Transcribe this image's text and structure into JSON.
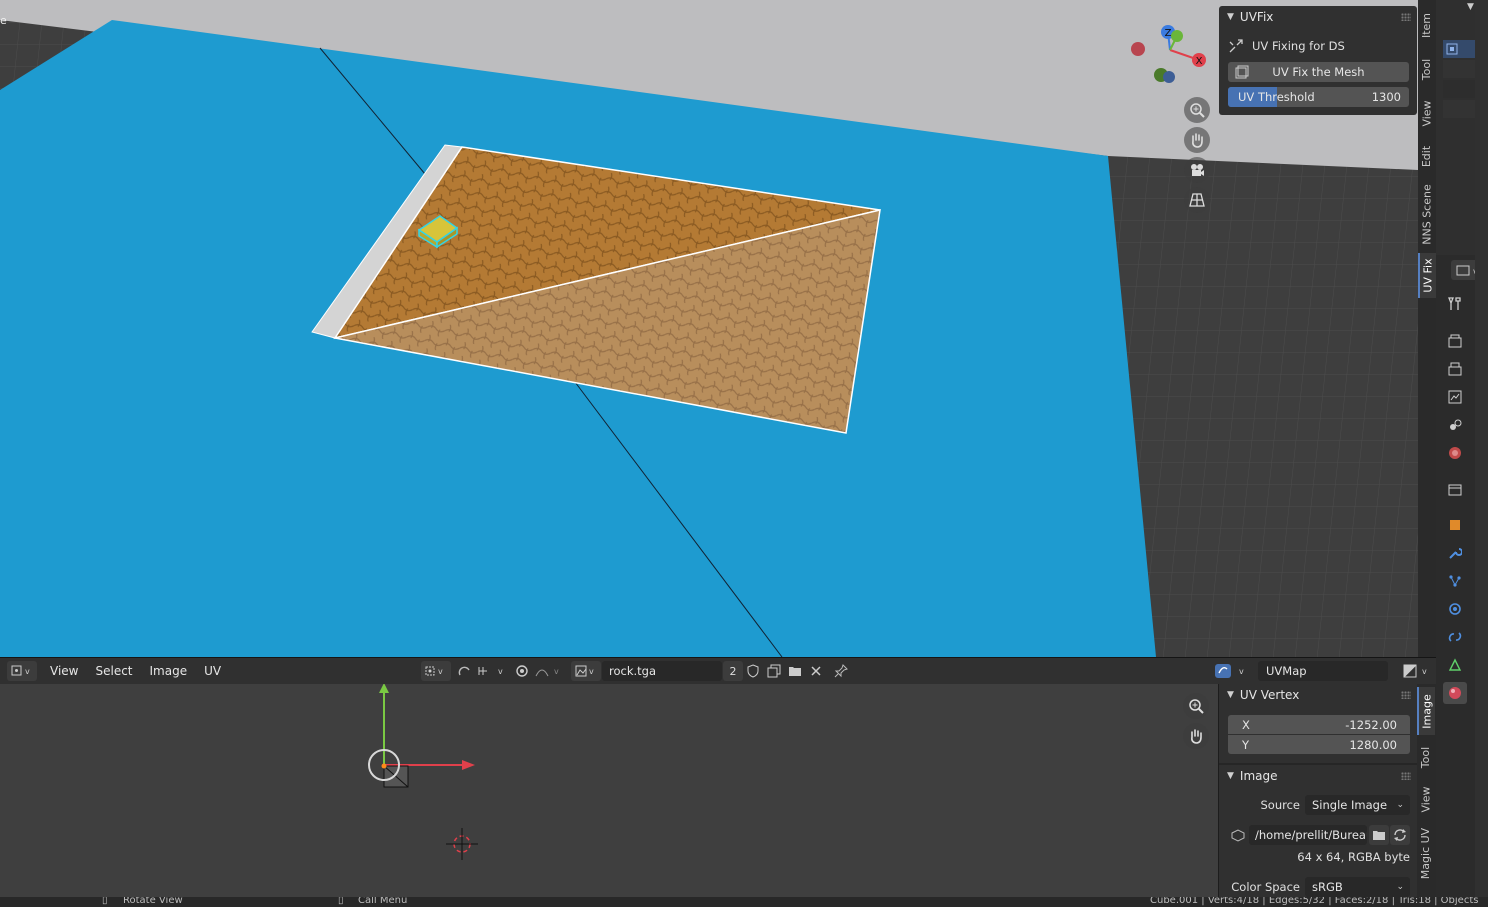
{
  "viewport3d": {
    "corner_text": "e",
    "gizmo_axes": {
      "z": "Z",
      "y": "Y",
      "x": "X"
    },
    "tabs": [
      "Item",
      "Tool",
      "View",
      "Edit",
      "NNS Scene",
      "UV Fix"
    ],
    "active_tab": "UV Fix"
  },
  "uvfix_panel": {
    "title": "UVFix",
    "subtitle": "UV Fixing for DS",
    "button_label": "UV Fix the Mesh",
    "threshold_label": "UV Threshold",
    "threshold_value": "1300",
    "threshold_fraction": 0.27
  },
  "uv_header": {
    "menus": [
      "View",
      "Select",
      "Image",
      "UV"
    ],
    "image_name": "rock.tga",
    "user_count": "2",
    "uv_map": "UVMap"
  },
  "uv_sidebar": {
    "tabs": [
      "Image",
      "Tool",
      "View",
      "Magic UV"
    ],
    "active_tab": "Image",
    "uv_vertex": {
      "title": "UV Vertex",
      "x_label": "X",
      "x_value": "-1252.00",
      "y_label": "Y",
      "y_value": "1280.00"
    },
    "image": {
      "title": "Image",
      "source_label": "Source",
      "source_value": "Single Image",
      "path": "/home/prellit/Bureau/...",
      "info": "64 x 64,  RGBA byte",
      "color_space_label": "Color Space",
      "color_space_value": "sRGB"
    }
  },
  "statusbar": {
    "left_text": "Rotate View",
    "mid_text": "Call Menu",
    "right_text": "Cube.001 | Verts:4/18 | Edges:5/32 | Faces:2/18 | Tris:18 | Objects"
  },
  "colors": {
    "accent": "#4772b3",
    "plane_blue": "#1e9bd0",
    "axis_x": "#e0404b",
    "axis_y": "#6ab63a",
    "axis_z": "#3a7be0"
  }
}
